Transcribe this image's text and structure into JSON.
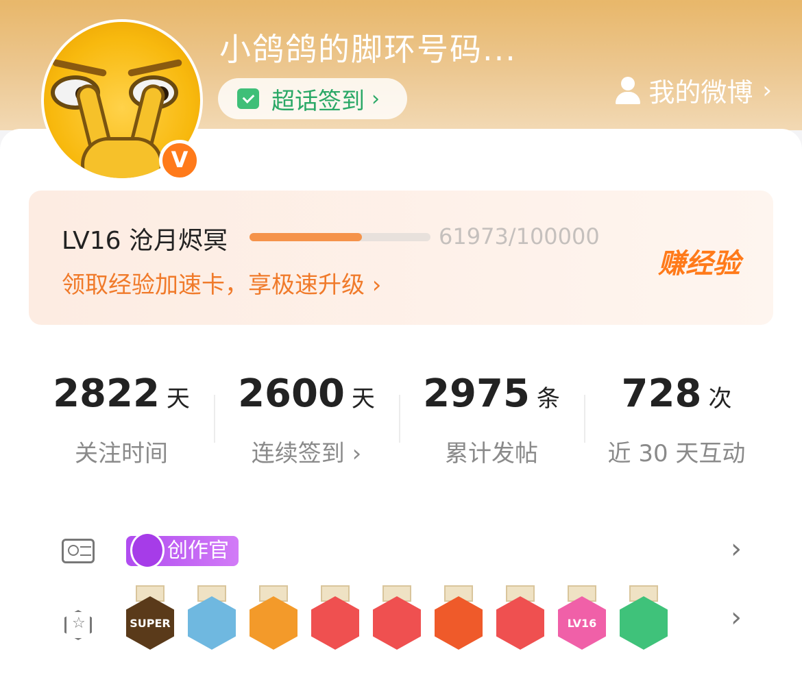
{
  "header": {
    "username": "小鸽鸽的脚环号码...",
    "signin_label": "超话签到",
    "signin_chevron": "›",
    "my_weibo": "我的微博",
    "my_weibo_chevron": "›",
    "verified_badge": "V"
  },
  "level": {
    "title": "LV16 沧月烬冥",
    "progress_text": "61973/100000",
    "progress_fraction": 0.61973,
    "subtitle": "领取经验加速卡，享极速升级 ›",
    "earn_label": "赚经验"
  },
  "stats": [
    {
      "value": "2822",
      "unit": "天",
      "label": "关注时间"
    },
    {
      "value": "2600",
      "unit": "天",
      "label": "连续签到 ›"
    },
    {
      "value": "2975",
      "unit": "条",
      "label": "累计发帖"
    },
    {
      "value": "728",
      "unit": "次",
      "label": "近 30 天互动"
    }
  ],
  "badges": {
    "creator_label": "创作官",
    "row_chevron": "›",
    "medals": [
      {
        "icon": "super-crown-medal",
        "text": "SUPER",
        "color": "#5a3a1a"
      },
      {
        "icon": "dragon-medal",
        "text": "",
        "color": "#6fb8e0"
      },
      {
        "icon": "crown-medal",
        "text": "",
        "color": "#f39a2a"
      },
      {
        "icon": "dragon-red-medal",
        "text": "",
        "color": "#ef5050"
      },
      {
        "icon": "dragon-red-medal-2",
        "text": "",
        "color": "#ef5050"
      },
      {
        "icon": "dragon-fire-medal",
        "text": "",
        "color": "#ef5a2a"
      },
      {
        "icon": "rabbit-medal",
        "text": "",
        "color": "#ef5050"
      },
      {
        "icon": "lv16-medal",
        "text": "LV16",
        "color": "#f060a8"
      },
      {
        "icon": "hand-medal",
        "text": "",
        "color": "#3fc27a"
      }
    ]
  },
  "colors": {
    "accent_orange": "#f07a2a",
    "progress": "#f5934a",
    "green": "#2aa866"
  }
}
